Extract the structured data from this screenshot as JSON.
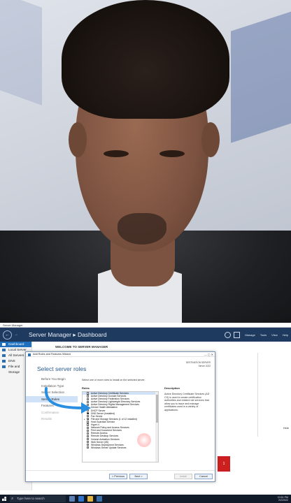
{
  "window": {
    "title": "Server Manager"
  },
  "header": {
    "title": "Server Manager",
    "separator": "▸",
    "section": "Dashboard",
    "menus": [
      "Manage",
      "Tools",
      "View",
      "Help"
    ]
  },
  "sidebar": {
    "items": [
      {
        "label": "Dashboard"
      },
      {
        "label": "Local Server"
      },
      {
        "label": "All Servers"
      },
      {
        "label": "DNS"
      },
      {
        "label": "File and Storage"
      }
    ]
  },
  "main": {
    "welcome": "WELCOME TO SERVER MANAGER",
    "hide": "Hide",
    "badge": "1"
  },
  "wizard": {
    "title": "Add Roles and Features Wizard",
    "heading": "Select server roles",
    "destination_line1": "DESTINATION SERVER",
    "destination_line2": "Server 2022",
    "steps": [
      {
        "label": "Before You Begin",
        "state": "normal"
      },
      {
        "label": "Installation Type",
        "state": "normal"
      },
      {
        "label": "Server Selection",
        "state": "normal"
      },
      {
        "label": "Server Roles",
        "state": "active"
      },
      {
        "label": "Features",
        "state": "normal"
      },
      {
        "label": "Confirmation",
        "state": "disabled"
      },
      {
        "label": "Results",
        "state": "disabled"
      }
    ],
    "intro": "Select one or more roles to install on the selected server.",
    "roles_header": "Roles",
    "description_header": "Description",
    "description": "Active Directory Certificate Services (AD CS) is used to create certification authorities and related role services that allow you to issue and manage certificates used in a variety of applications.",
    "roles": [
      {
        "label": "Active Directory Certificate Services",
        "checked": false,
        "selected": true
      },
      {
        "label": "Active Directory Domain Services",
        "checked": false
      },
      {
        "label": "Active Directory Federation Services",
        "checked": false
      },
      {
        "label": "Active Directory Lightweight Directory Services",
        "checked": false
      },
      {
        "label": "Active Directory Rights Management Services",
        "checked": false
      },
      {
        "label": "Device Health Attestation",
        "checked": false
      },
      {
        "label": "DHCP Server",
        "checked": false
      },
      {
        "label": "DNS Server (Installed)",
        "checked": true
      },
      {
        "label": "Fax Server",
        "checked": false
      },
      {
        "label": "File and Storage Services (1 of 12 installed)",
        "checked": true,
        "expandable": true
      },
      {
        "label": "Host Guardian Service",
        "checked": false
      },
      {
        "label": "Hyper-V",
        "checked": false
      },
      {
        "label": "Network Policy and Access Services",
        "checked": false
      },
      {
        "label": "Print and Document Services",
        "checked": false
      },
      {
        "label": "Remote Access",
        "checked": false
      },
      {
        "label": "Remote Desktop Services",
        "checked": false
      },
      {
        "label": "Volume Activation Services",
        "checked": false
      },
      {
        "label": "Web Server (IIS)",
        "checked": false
      },
      {
        "label": "Windows Deployment Services",
        "checked": false
      },
      {
        "label": "Windows Server Update Services",
        "checked": false
      }
    ],
    "buttons": {
      "previous": "< Previous",
      "next": "Next >",
      "install": "Install",
      "cancel": "Cancel"
    }
  },
  "taskbar": {
    "search_placeholder": "Type here to search",
    "time": "10:51 PM",
    "date": "2/2/2022"
  },
  "colors": {
    "header_bg": "#1e3a5f",
    "accent": "#1f6fbf",
    "arrow": "#2a8fe0",
    "badge": "#cc1f1f"
  }
}
